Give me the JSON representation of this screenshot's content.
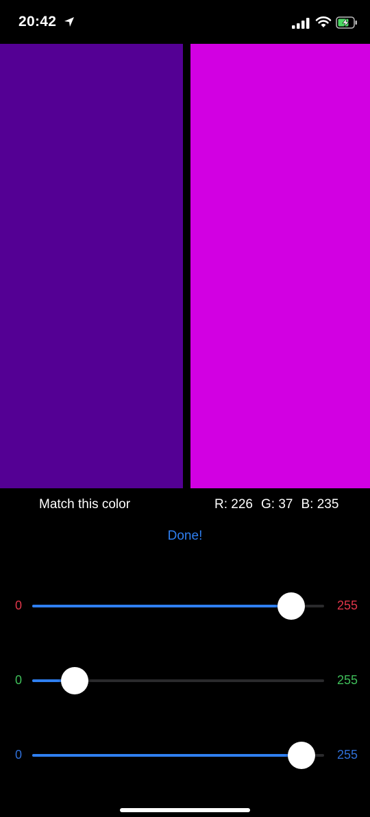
{
  "status_bar": {
    "time": "20:42",
    "icons": [
      "location-arrow-icon",
      "signal-icon",
      "wifi-icon",
      "battery-charging-icon"
    ]
  },
  "panels": {
    "target_color": "#540094",
    "guess_color": "#d200e2"
  },
  "target_label": "Match this color",
  "readout": {
    "r": "R: 226",
    "g": "G: 37",
    "b": "B: 235"
  },
  "done_label": "Done!",
  "accent_color": "#2f7ff0",
  "sliders": [
    {
      "channel": "red",
      "min_label": "0",
      "max_label": "255",
      "label_color": "#e0364a",
      "value": 226,
      "max": 255
    },
    {
      "channel": "green",
      "min_label": "0",
      "max_label": "255",
      "label_color": "#3fbf5a",
      "value": 37,
      "max": 255
    },
    {
      "channel": "blue",
      "min_label": "0",
      "max_label": "255",
      "label_color": "#2f6fd8",
      "value": 235,
      "max": 255
    }
  ]
}
